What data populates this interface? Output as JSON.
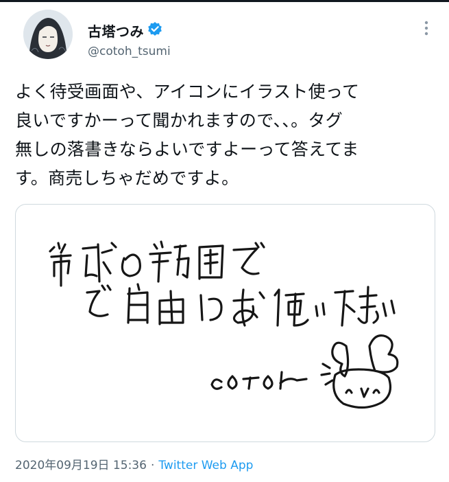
{
  "author": {
    "display_name": "古塔つみ",
    "handle": "@cotoh_tsumi",
    "verified": true
  },
  "tweet": {
    "text": "よく待受画面や、アイコンにイラスト使って\n良いですかーって聞かれますので、、。タグ\n無しの落書きならよいですよーって答えてま\nす。商売しちゃだめですよ。",
    "timestamp": "2020年09月19日 15:36",
    "separator": "·",
    "source_app": "Twitter Web App"
  },
  "media": {
    "handwritten_line1": "常識の範囲で",
    "handwritten_line2": "ご自由にお使い下さい",
    "signature": "COTOH"
  },
  "colors": {
    "link": "#1d9bf0",
    "verified_badge": "#1d9bf0",
    "secondary_text": "#536471",
    "border": "#cfd9de"
  },
  "icons": {
    "verified": "verified-badge-icon",
    "more": "more-vertical-icon"
  }
}
